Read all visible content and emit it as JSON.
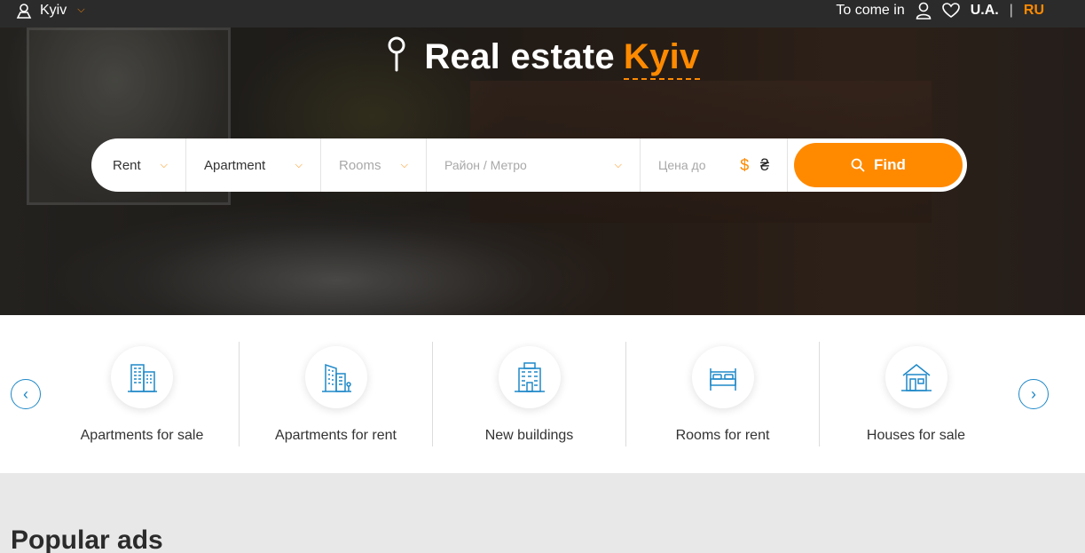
{
  "topbar": {
    "city": "Kyiv",
    "login": "To come in",
    "lang_ua": "U.A.",
    "separator": "|",
    "lang_ru": "RU"
  },
  "hero": {
    "title_prefix": "Real estate",
    "title_city": "Kyiv"
  },
  "search": {
    "deal": "Rent",
    "type": "Apartment",
    "rooms": "Rooms",
    "district": "Район / Метро",
    "price": "Цена до",
    "currency_usd": "$",
    "currency_uah": "₴",
    "find": "Find"
  },
  "categories": [
    {
      "label": "Apartments for sale",
      "icon": "apartment-building-icon"
    },
    {
      "label": "Apartments for rent",
      "icon": "apartment-rent-icon"
    },
    {
      "label": "New buildings",
      "icon": "new-building-icon"
    },
    {
      "label": "Rooms for rent",
      "icon": "bed-icon"
    },
    {
      "label": "Houses for sale",
      "icon": "house-icon"
    }
  ],
  "section_title": "Popular ads",
  "colors": {
    "accent": "#ff8a00",
    "icon_blue": "#1e88c8",
    "topbar": "#2b2b2b"
  }
}
